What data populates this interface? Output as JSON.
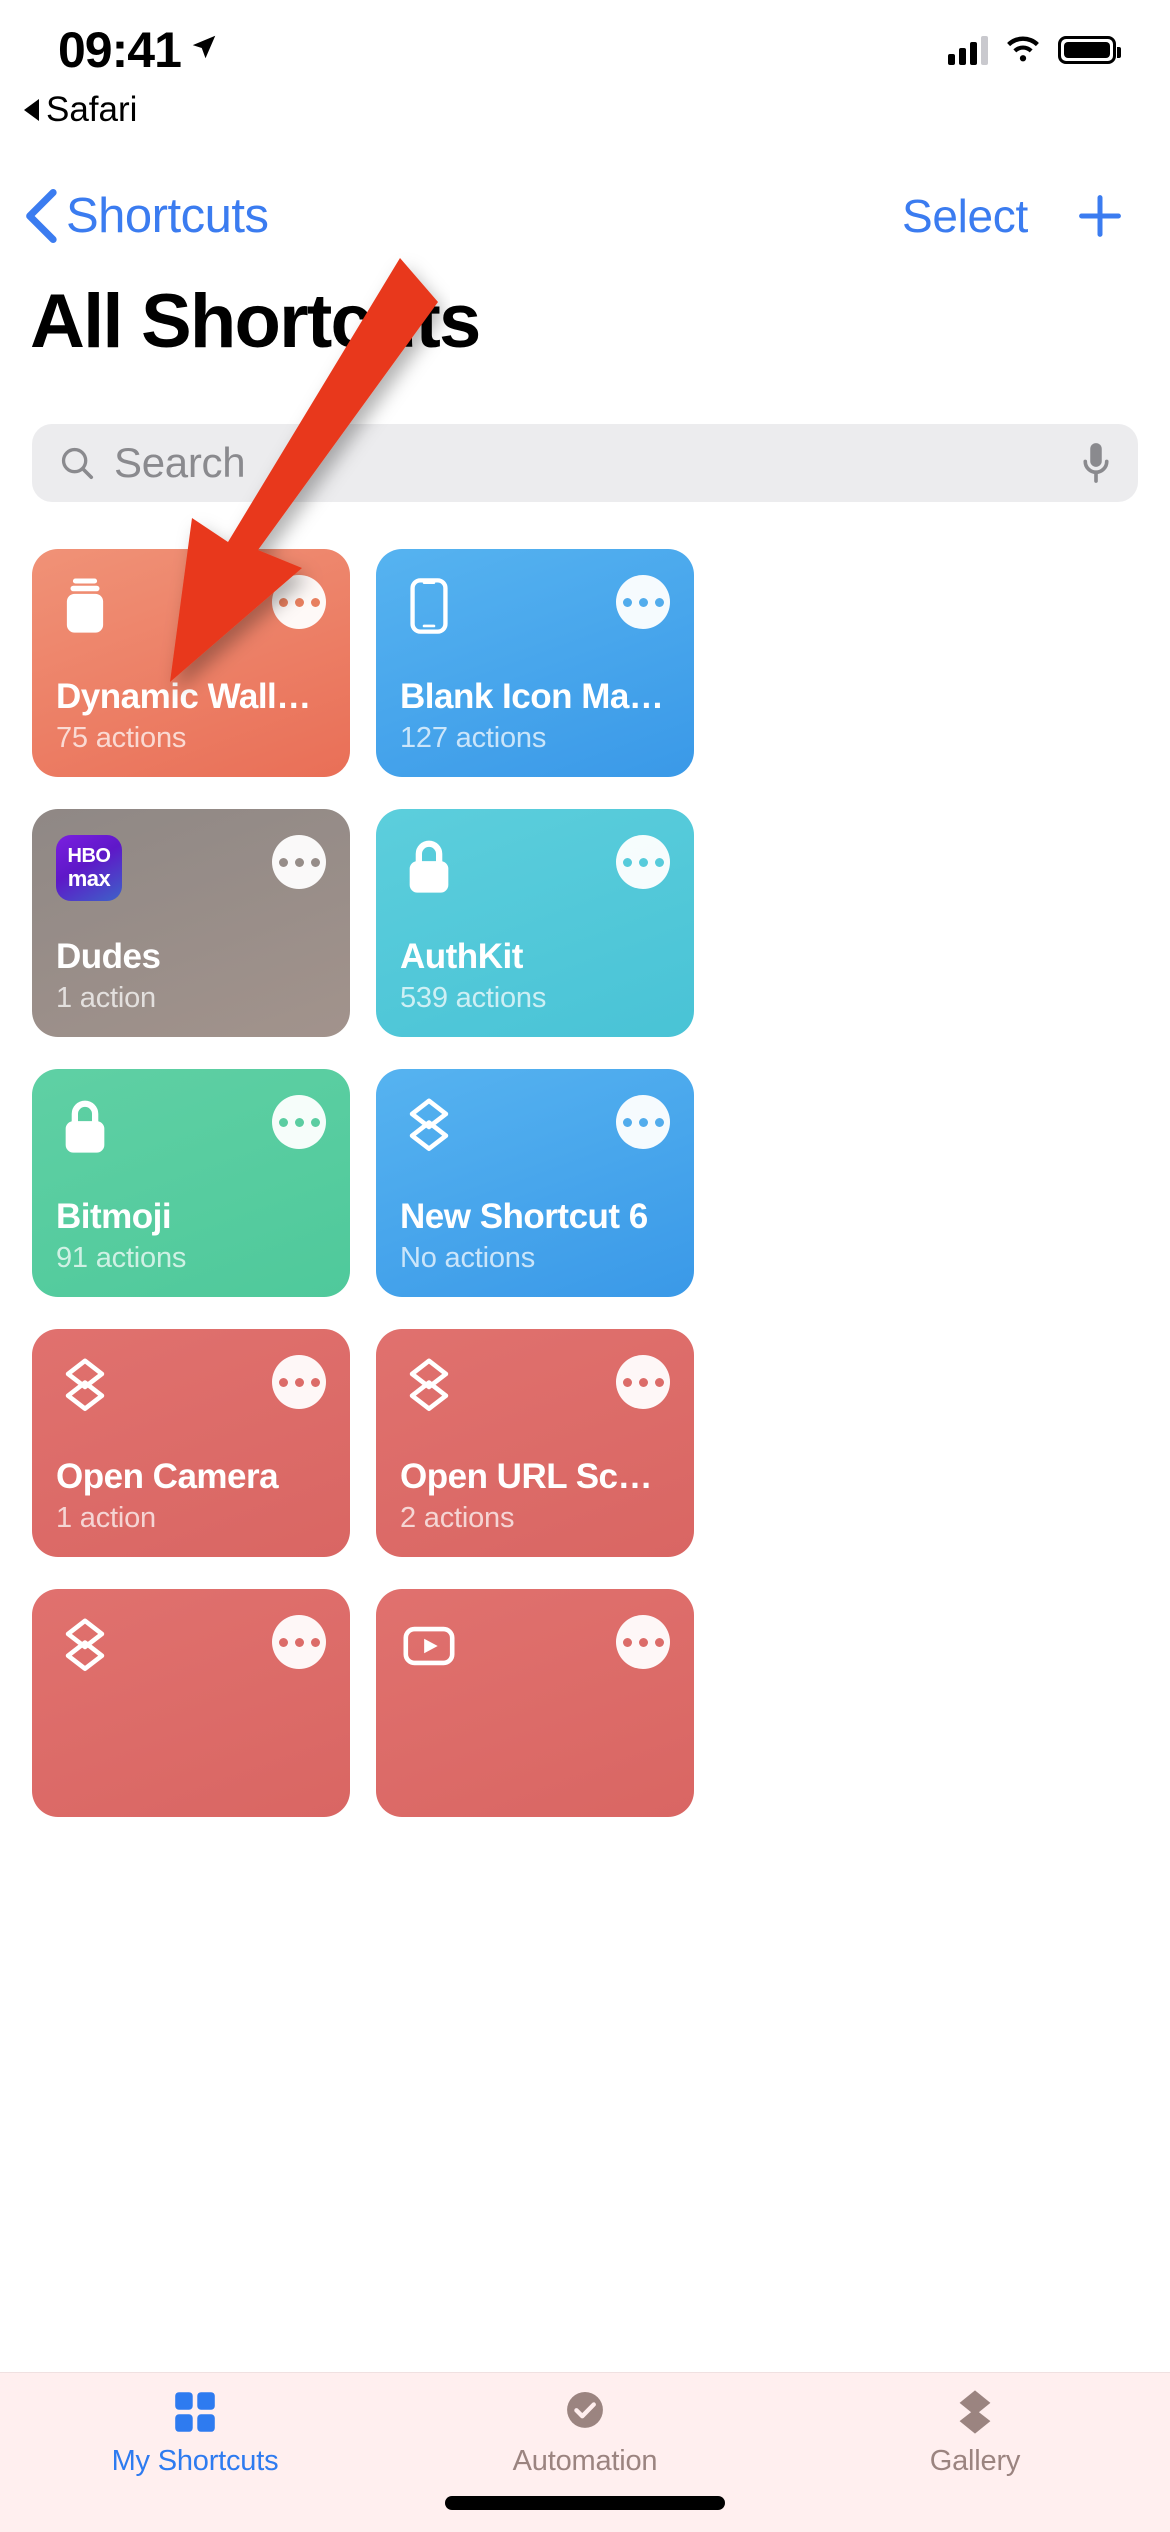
{
  "status_bar": {
    "time": "09:41",
    "location_icon": "location-arrow-icon",
    "cellular_icon": "cellular-signal-icon",
    "wifi_icon": "wifi-icon",
    "battery_icon": "battery-full-icon"
  },
  "back_to_app": {
    "label": "Safari",
    "icon": "back-triangle-icon"
  },
  "nav_bar": {
    "back_label": "Shortcuts",
    "back_icon": "chevron-left-icon",
    "select_label": "Select",
    "add_icon": "plus-icon"
  },
  "page_title": "All Shortcuts",
  "search": {
    "placeholder": "Search",
    "icon": "search-icon",
    "mic_icon": "microphone-icon",
    "background": "#ECECEE"
  },
  "annotation": {
    "type": "red-arrow-pointer",
    "color": "#E8381C"
  },
  "shortcuts": [
    {
      "title": "Dynamic Wallpaper",
      "subtitle": "75 actions",
      "glyph": "jar-icon",
      "color_top": "#F09277",
      "color_bottom": "#E96F57",
      "dot_color": "#E8805F"
    },
    {
      "title": "Blank Icon Maker",
      "subtitle": "127 actions",
      "glyph": "iphone-icon",
      "color_top": "#56B3F0",
      "color_bottom": "#3A99E8",
      "dot_color": "#52ACEC"
    },
    {
      "title": "Dudes",
      "subtitle": "1 action",
      "glyph": "hbomax-app-icon",
      "glyph_line1": "HBO",
      "glyph_line2": "max",
      "color_top": "#8F8885",
      "color_bottom": "#A2938C",
      "dot_color": "#968D89"
    },
    {
      "title": "AuthKit",
      "subtitle": "539 actions",
      "glyph": "lock-icon",
      "color_top": "#5CCEDC",
      "color_bottom": "#49C3D6",
      "dot_color": "#57CBDB"
    },
    {
      "title": "Bitmoji",
      "subtitle": "91 actions",
      "glyph": "lock-icon",
      "color_top": "#5FD0A4",
      "color_bottom": "#4FC99B",
      "dot_color": "#5BCDA1"
    },
    {
      "title": "New Shortcut 6",
      "subtitle": "No actions",
      "glyph": "shortcuts-layers-icon",
      "color_top": "#56B3F0",
      "color_bottom": "#3A99E8",
      "dot_color": "#52ACEC"
    },
    {
      "title": "Open Camera",
      "subtitle": "1 action",
      "glyph": "shortcuts-layers-icon",
      "color_top": "#E0716E",
      "color_bottom": "#D96663",
      "dot_color": "#DC6C69"
    },
    {
      "title": "Open URL Scheme",
      "subtitle": "2 actions",
      "glyph": "shortcuts-layers-icon",
      "color_top": "#E0716E",
      "color_bottom": "#D96663",
      "dot_color": "#DC6C69"
    },
    {
      "title": "",
      "subtitle": "",
      "glyph": "shortcuts-layers-icon",
      "color_top": "#E0716E",
      "color_bottom": "#D96663",
      "dot_color": "#DC6C69"
    },
    {
      "title": "",
      "subtitle": "",
      "glyph": "play-button-icon",
      "color_top": "#E0716E",
      "color_bottom": "#D96663",
      "dot_color": "#DC6C69"
    }
  ],
  "tab_bar": {
    "tabs": [
      {
        "label": "My Shortcuts",
        "icon": "grid-squares-icon",
        "active": true
      },
      {
        "label": "Automation",
        "icon": "automation-check-icon",
        "active": false
      },
      {
        "label": "Gallery",
        "icon": "gallery-layers-icon",
        "active": false
      }
    ],
    "active_color": "#2E7BF0",
    "inactive_color": "#9B8480"
  }
}
